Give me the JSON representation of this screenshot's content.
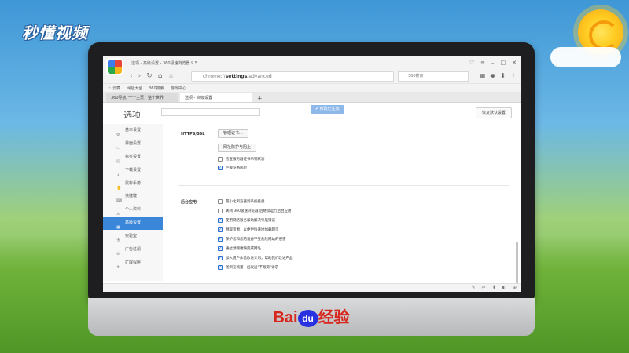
{
  "watermark": {
    "left_logo": "秒懂视频"
  },
  "brand": {
    "prefix": "Bai",
    "mid": "du",
    "suffix": "经验"
  },
  "browser": {
    "window_title": "选项 - 高级设置 - 360极速浏览器 9.5",
    "address": {
      "scheme": "chrome://",
      "path": "settings",
      "rest": "/advanced"
    },
    "search_placeholder": "360搜索",
    "bookmarks": [
      "☆ 云藏",
      "网址大全",
      "360搜索",
      "游戏中心"
    ],
    "tabs": [
      {
        "label": "360导航_一个主页，整个世界",
        "active": false
      },
      {
        "label": "选项 - 高级设置",
        "active": true
      }
    ],
    "tab_add": "+"
  },
  "settings": {
    "title": "选项",
    "saved_badge": "✔ 修改已生效",
    "reset_button": "恢复默认设置",
    "sidebar": [
      {
        "icon": "⚙",
        "label": "基本设置",
        "active": false
      },
      {
        "icon": "▭",
        "label": "界面设置",
        "active": false
      },
      {
        "icon": "▤",
        "label": "标签设置",
        "active": false
      },
      {
        "icon": "↓",
        "label": "下载设置",
        "active": false
      },
      {
        "icon": "✋",
        "label": "鼠标手势",
        "active": false
      },
      {
        "icon": "⌨",
        "label": "快捷键",
        "active": false
      },
      {
        "icon": "♙",
        "label": "个人资料",
        "active": false
      },
      {
        "icon": "▦",
        "label": "高级设置",
        "active": true
      },
      {
        "icon": "⚗",
        "label": "实验室",
        "active": false
      },
      {
        "icon": "⊘",
        "label": "广告过滤",
        "active": false
      },
      {
        "icon": "✚",
        "label": "扩展程序",
        "active": false
      }
    ],
    "https": {
      "label": "HTTPS/SSL",
      "manage_cert_button": "管理证书...",
      "site_proxy_button": "网址防护与阻止",
      "options": [
        {
          "label": "检查服务器证书吊销状态",
          "checked": false
        },
        {
          "label": "拦截证书风险",
          "checked": true
        }
      ]
    },
    "background": {
      "label": "后台应用",
      "options": [
        {
          "label": "最小化浏览器到系统托盘",
          "checked": false
        },
        {
          "label": "关闭 360极速浏览器 后继续运行后台应用",
          "checked": false
        },
        {
          "label": "使用网络服务帮助解决导航错误",
          "checked": true
        },
        {
          "label": "预取资源，以便更快速地加载网页",
          "checked": true
        },
        {
          "label": "保护您和您的设备不受危险网站的侵害",
          "checked": true
        },
        {
          "label": "通过预测更快完成网址",
          "checked": true
        },
        {
          "label": "加入用户体验改进计划，帮助我们改进产品",
          "checked": true
        },
        {
          "label": "随浏览流量一起发送\"不跟踪\"请求",
          "checked": true
        }
      ]
    }
  },
  "colors": {
    "accent": "#3a86d8"
  }
}
